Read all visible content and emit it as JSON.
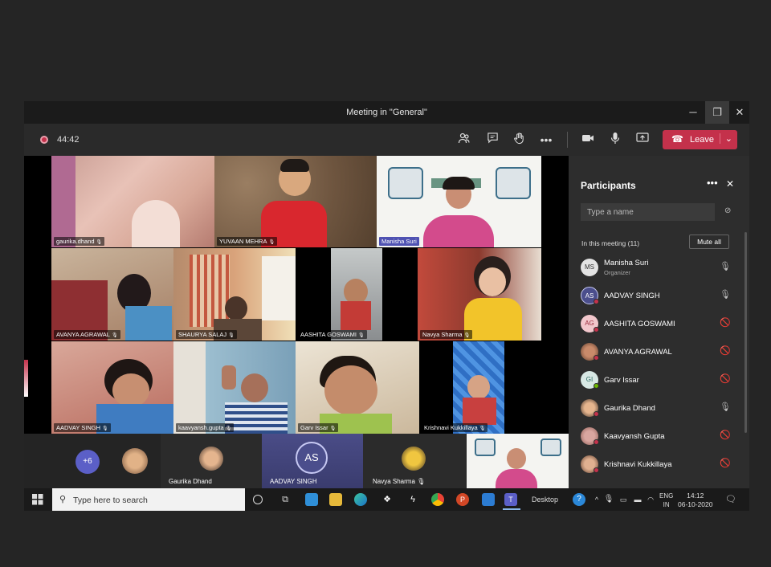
{
  "window": {
    "title": "Meeting in \"General\"",
    "minimize": "─",
    "maximize": "❐",
    "close": "✕"
  },
  "toolbar": {
    "timer": "44:42",
    "leave_label": "Leave"
  },
  "tiles": [
    {
      "name": "gaurika.dhand",
      "mic": true
    },
    {
      "name": "YUVAAN  MEHRA",
      "mic": true
    },
    {
      "name": "Manisha Suri",
      "mic": false
    },
    {
      "name": "AVANYA  AGRAWAL",
      "mic": true
    },
    {
      "name": "SHAURYA  SALAJ",
      "mic": true
    },
    {
      "name": "AASHITA GOSWAMI",
      "mic": true
    },
    {
      "name": "Navya  Sharma",
      "mic": true
    },
    {
      "name": "AADVAY   SINGH",
      "mic": true
    },
    {
      "name": "kaavyansh.gupta",
      "mic": true
    },
    {
      "name": "Garv   Issar",
      "mic": true
    },
    {
      "name": "Krishnavi  Kukkillaya",
      "mic": true
    }
  ],
  "strip": {
    "overflow": "+6",
    "people": [
      {
        "name": "Gaurika Dhand"
      },
      {
        "name": "AADVAY SINGH",
        "initials": "AS"
      },
      {
        "name": "Navya Sharma"
      }
    ]
  },
  "participants_panel": {
    "title": "Participants",
    "search_placeholder": "Type a name",
    "in_meeting": "In this meeting (11)",
    "mute_all": "Mute all",
    "people": [
      {
        "name": "Manisha Suri",
        "role": "Organizer",
        "initials": "MS",
        "muted": false
      },
      {
        "name": "AADVAY SINGH",
        "initials": "AS",
        "muted": false
      },
      {
        "name": "AASHITA GOSWAMI",
        "initials": "AG",
        "muted": true
      },
      {
        "name": "AVANYA AGRAWAL",
        "initials": "",
        "muted": true
      },
      {
        "name": "Garv Issar",
        "initials": "GI",
        "muted": true
      },
      {
        "name": "Gaurika Dhand",
        "initials": "",
        "muted": false
      },
      {
        "name": "Kaavyansh Gupta",
        "initials": "",
        "muted": true
      },
      {
        "name": "Krishnavi Kukkillaya",
        "initials": "",
        "muted": true
      }
    ]
  },
  "taskbar": {
    "search_text": "Type here to search",
    "desktop": "Desktop",
    "lang_top": "ENG",
    "lang_bottom": "IN",
    "time": "14:12",
    "date": "06-10-2020"
  }
}
